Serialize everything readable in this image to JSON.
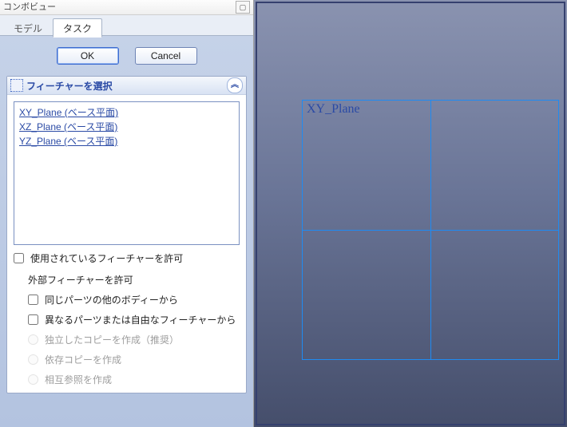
{
  "panel": {
    "title": "コンボビュー",
    "tabs": {
      "model": "モデル",
      "task": "タスク"
    },
    "buttons": {
      "ok": "OK",
      "cancel": "Cancel"
    }
  },
  "task_card": {
    "title": "フィーチャーを選択",
    "collapse_glyph": "︽",
    "items": [
      "XY_Plane (ベース平面)",
      "XZ_Plane (ベース平面)",
      "YZ_Plane (ベース平面)"
    ]
  },
  "options": {
    "allow_used": "使用されているフィーチャーを許可",
    "allow_external_header": "外部フィーチャーを許可",
    "same_part_other_body": "同じパーツの他のボディーから",
    "different_part_or_free": "異なるパーツまたは自由なフィーチャーから",
    "independent_copy": "独立したコピーを作成（推奨）",
    "dependent_copy": "依存コピーを作成",
    "cross_reference": "相互参照を作成"
  },
  "viewport": {
    "plane_label": "XY_Plane"
  }
}
